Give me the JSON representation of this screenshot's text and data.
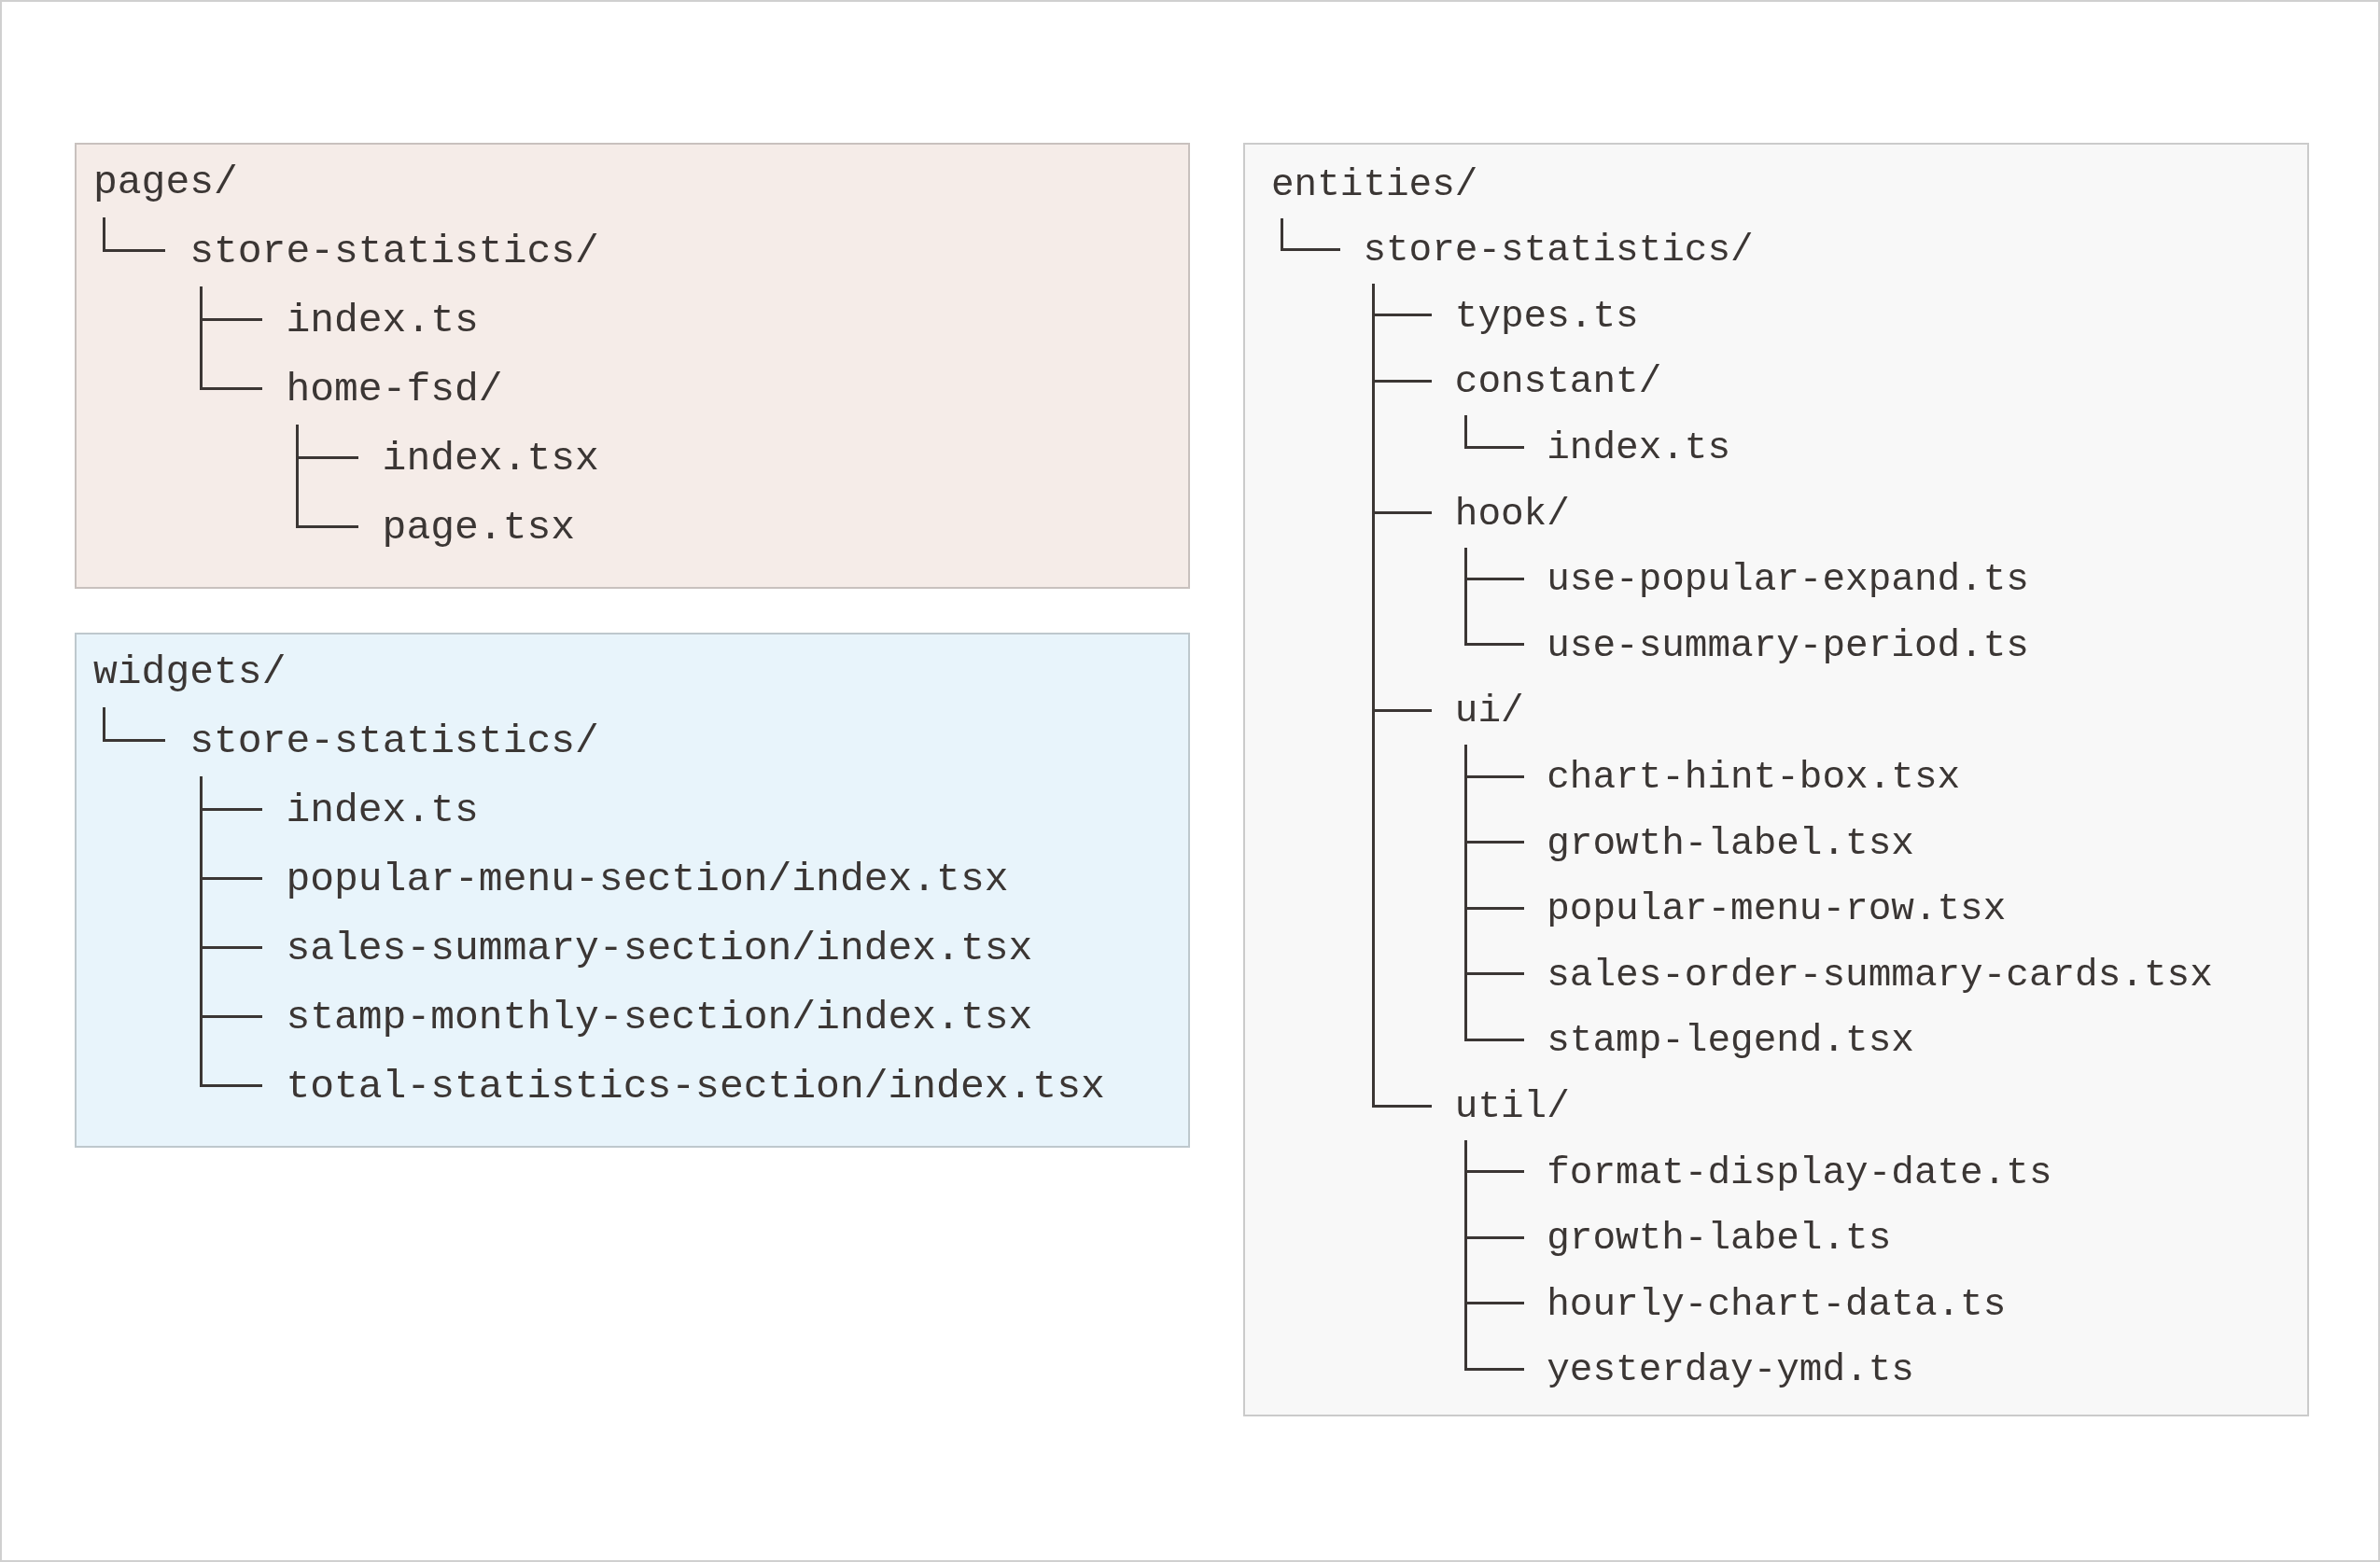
{
  "left_column": {
    "panels": [
      {
        "color": "#f5ece8",
        "tree": {
          "name": "pages/",
          "children": [
            {
              "name": "store-statistics/",
              "children": [
                {
                  "name": "index.ts"
                },
                {
                  "name": "home-fsd/",
                  "children": [
                    {
                      "name": "index.tsx"
                    },
                    {
                      "name": "page.tsx"
                    }
                  ]
                }
              ]
            }
          ]
        }
      },
      {
        "color": "#e8f4fb",
        "tree": {
          "name": "widgets/",
          "children": [
            {
              "name": "store-statistics/",
              "children": [
                {
                  "name": "index.ts"
                },
                {
                  "name": "popular-menu-section/index.tsx"
                },
                {
                  "name": "sales-summary-section/index.tsx"
                },
                {
                  "name": "stamp-monthly-section/index.tsx"
                },
                {
                  "name": "total-statistics-section/index.tsx"
                }
              ]
            }
          ]
        }
      }
    ]
  },
  "right_column": {
    "panels": [
      {
        "color": "#f8f8f8",
        "tree": {
          "name": "entities/",
          "children": [
            {
              "name": "store-statistics/",
              "children": [
                {
                  "name": "types.ts"
                },
                {
                  "name": "constant/",
                  "children": [
                    {
                      "name": "index.ts"
                    }
                  ]
                },
                {
                  "name": "hook/",
                  "children": [
                    {
                      "name": "use-popular-expand.ts"
                    },
                    {
                      "name": "use-summary-period.ts"
                    }
                  ]
                },
                {
                  "name": "ui/",
                  "children": [
                    {
                      "name": "chart-hint-box.tsx"
                    },
                    {
                      "name": "growth-label.tsx"
                    },
                    {
                      "name": "popular-menu-row.tsx"
                    },
                    {
                      "name": "sales-order-summary-cards.tsx"
                    },
                    {
                      "name": "stamp-legend.tsx"
                    }
                  ]
                },
                {
                  "name": "util/",
                  "children": [
                    {
                      "name": "format-display-date.ts"
                    },
                    {
                      "name": "growth-label.ts"
                    },
                    {
                      "name": "hourly-chart-data.ts"
                    },
                    {
                      "name": "yesterday-ymd.ts"
                    }
                  ]
                }
              ]
            }
          ]
        }
      }
    ]
  }
}
